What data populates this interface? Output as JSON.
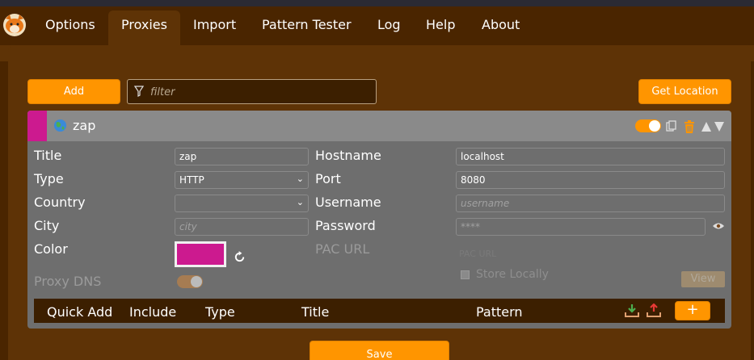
{
  "nav": {
    "tabs": [
      {
        "label": "Options"
      },
      {
        "label": "Proxies"
      },
      {
        "label": "Import"
      },
      {
        "label": "Pattern Tester"
      },
      {
        "label": "Log"
      },
      {
        "label": "Help"
      },
      {
        "label": "About"
      }
    ],
    "active_tab": "Proxies"
  },
  "toolbar": {
    "add_label": "Add",
    "filter_placeholder": "filter",
    "get_location_label": "Get Location"
  },
  "proxy": {
    "name": "zap",
    "enabled": true,
    "color": "#cc1a8f",
    "fields": {
      "title_label": "Title",
      "title_value": "zap",
      "type_label": "Type",
      "type_value": "HTTP",
      "country_label": "Country",
      "country_value": "",
      "city_label": "City",
      "city_placeholder": "city",
      "color_label": "Color",
      "proxy_dns_label": "Proxy DNS",
      "hostname_label": "Hostname",
      "hostname_value": "localhost",
      "port_label": "Port",
      "port_value": "8080",
      "username_label": "Username",
      "username_placeholder": "username",
      "password_label": "Password",
      "password_placeholder": "****",
      "pac_url_label": "PAC URL",
      "pac_url_placeholder": "PAC URL",
      "store_locally_label": "Store Locally",
      "view_label": "View"
    },
    "pattern_columns": [
      "Quick Add",
      "Include",
      "Type",
      "Title",
      "Pattern"
    ],
    "add_pattern_label": "+"
  },
  "footer": {
    "save_label": "Save"
  },
  "colors": {
    "accent": "#ff9500",
    "background": "#4a2500",
    "panel": "#5e3306",
    "card": "#6e6e6e"
  }
}
